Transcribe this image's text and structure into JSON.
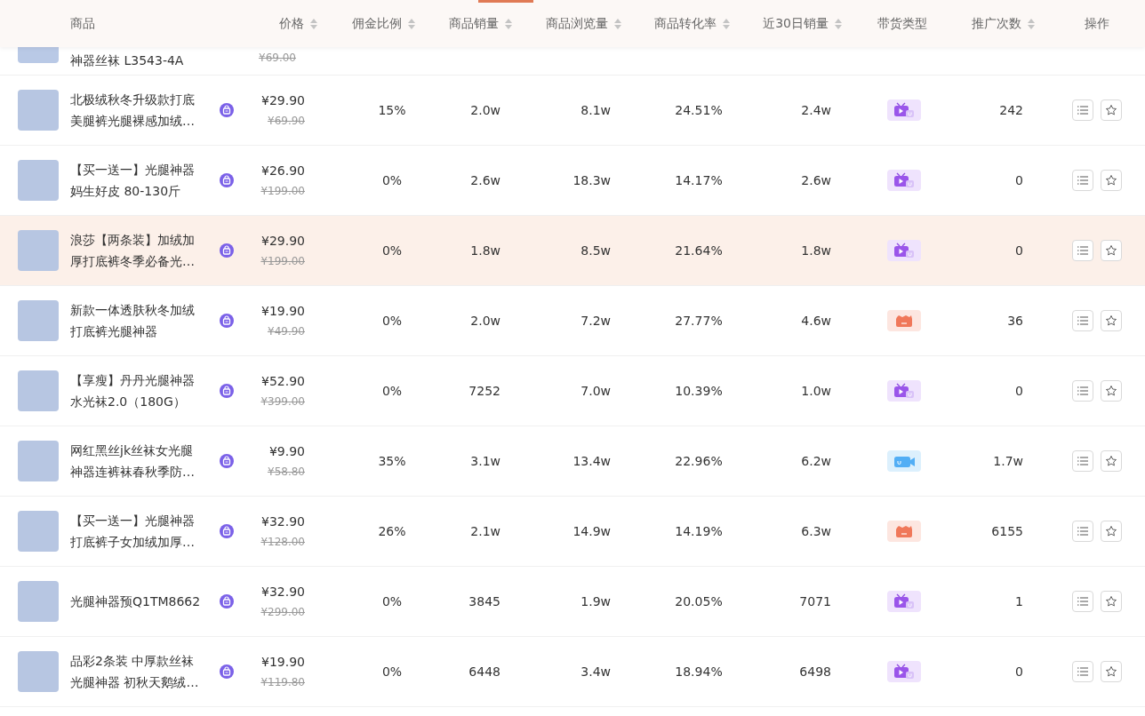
{
  "columns": [
    {
      "label": "商品",
      "sortable": false
    },
    {
      "label": "价格",
      "sortable": true
    },
    {
      "label": "佣金比例",
      "sortable": true
    },
    {
      "label": "商品销量",
      "sortable": true
    },
    {
      "label": "商品浏览量",
      "sortable": true
    },
    {
      "label": "商品转化率",
      "sortable": true
    },
    {
      "label": "近30日销量",
      "sortable": true
    },
    {
      "label": "带货类型",
      "sortable": false
    },
    {
      "label": "推广次数",
      "sortable": true
    },
    {
      "label": "操作",
      "sortable": false
    }
  ],
  "partial_row": {
    "name": "神器丝袜 L3543-4A",
    "original_price": "¥69.00"
  },
  "rows": [
    {
      "name_lines": [
        "北极绒秋冬升级款打底",
        "美腿裤光腿裸感加绒…"
      ],
      "price": "¥29.90",
      "original_price": "¥69.90",
      "commission": "15%",
      "sales": "2.0w",
      "views": "8.1w",
      "conversion": "24.51%",
      "sales_30d": "2.4w",
      "kind": "live",
      "promotions": "242",
      "highlighted": false
    },
    {
      "name_lines": [
        "【买一送一】光腿神器",
        "妈生好皮 80-130斤"
      ],
      "price": "¥26.90",
      "original_price": "¥199.00",
      "commission": "0%",
      "sales": "2.6w",
      "views": "18.3w",
      "conversion": "14.17%",
      "sales_30d": "2.6w",
      "kind": "live",
      "promotions": "0",
      "highlighted": false
    },
    {
      "name_lines": [
        "浪莎【两条装】加绒加",
        "厚打底裤冬季必备光…"
      ],
      "price": "¥29.90",
      "original_price": "¥199.00",
      "commission": "0%",
      "sales": "1.8w",
      "views": "8.5w",
      "conversion": "21.64%",
      "sales_30d": "1.8w",
      "kind": "live",
      "promotions": "0",
      "highlighted": true
    },
    {
      "name_lines": [
        "新款一体透肤秋冬加绒",
        "打底裤光腿神器"
      ],
      "price": "¥19.90",
      "original_price": "¥49.90",
      "commission": "0%",
      "sales": "2.0w",
      "views": "7.2w",
      "conversion": "27.77%",
      "sales_30d": "4.6w",
      "kind": "shop",
      "promotions": "36",
      "highlighted": false
    },
    {
      "name_lines": [
        "【享瘦】丹丹光腿神器",
        "水光袜2.0（180G）"
      ],
      "price": "¥52.90",
      "original_price": "¥399.00",
      "commission": "0%",
      "sales": "7252",
      "views": "7.0w",
      "conversion": "10.39%",
      "sales_30d": "1.0w",
      "kind": "live",
      "promotions": "0",
      "highlighted": false
    },
    {
      "name_lines": [
        "网红黑丝jk丝袜女光腿",
        "神器连裤袜春秋季防…"
      ],
      "price": "¥9.90",
      "original_price": "¥58.80",
      "commission": "35%",
      "sales": "3.1w",
      "views": "13.4w",
      "conversion": "22.96%",
      "sales_30d": "6.2w",
      "kind": "video",
      "promotions": "1.7w",
      "highlighted": false
    },
    {
      "name_lines": [
        "【买一送一】光腿神器",
        "打底裤子女加绒加厚…"
      ],
      "price": "¥32.90",
      "original_price": "¥128.00",
      "commission": "26%",
      "sales": "2.1w",
      "views": "14.9w",
      "conversion": "14.19%",
      "sales_30d": "6.3w",
      "kind": "shop",
      "promotions": "6155",
      "highlighted": false
    },
    {
      "name_lines": [
        "光腿神器预Q1TM8662"
      ],
      "price": "¥32.90",
      "original_price": "¥299.00",
      "commission": "0%",
      "sales": "3845",
      "views": "1.9w",
      "conversion": "20.05%",
      "sales_30d": "7071",
      "kind": "live",
      "promotions": "1",
      "highlighted": false
    },
    {
      "name_lines": [
        "品彩2条装 中厚款丝袜",
        "光腿神器 初秋天鹅绒…"
      ],
      "price": "¥19.90",
      "original_price": "¥119.80",
      "commission": "0%",
      "sales": "6448",
      "views": "3.4w",
      "conversion": "18.94%",
      "sales_30d": "6498",
      "kind": "live",
      "promotions": "0",
      "highlighted": false
    }
  ]
}
